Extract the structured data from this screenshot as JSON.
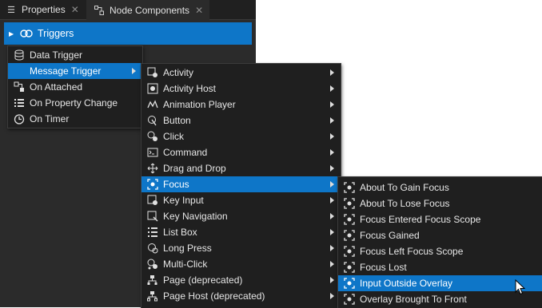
{
  "tabs": [
    {
      "label": "Properties",
      "icon": "list-icon",
      "close": "✕"
    },
    {
      "label": "Node Components",
      "icon": "node-components-icon",
      "close": "✕"
    }
  ],
  "tree": {
    "label": "Triggers",
    "icon": "trigger-icon"
  },
  "menu_level1": {
    "items": [
      {
        "label": "Data Trigger",
        "icon": "database-icon",
        "selected": false,
        "submenu": false
      },
      {
        "label": "Message Trigger",
        "icon": "message-icon",
        "selected": true,
        "submenu": true
      },
      {
        "label": "On Attached",
        "icon": "attach-icon",
        "selected": false,
        "submenu": false
      },
      {
        "label": "On Property Change",
        "icon": "property-list-icon",
        "selected": false,
        "submenu": false
      },
      {
        "label": "On Timer",
        "icon": "timer-icon",
        "selected": false,
        "submenu": false
      }
    ]
  },
  "menu_level2": {
    "items": [
      {
        "label": "Activity",
        "icon": "activity-icon"
      },
      {
        "label": "Activity Host",
        "icon": "activity-host-icon"
      },
      {
        "label": "Animation Player",
        "icon": "animation-icon"
      },
      {
        "label": "Button",
        "icon": "button-icon"
      },
      {
        "label": "Click",
        "icon": "click-icon"
      },
      {
        "label": "Command",
        "icon": "command-icon"
      },
      {
        "label": "Drag and Drop",
        "icon": "drag-drop-icon"
      },
      {
        "label": "Focus",
        "icon": "focus-icon",
        "selected": true
      },
      {
        "label": "Key Input",
        "icon": "key-input-icon"
      },
      {
        "label": "Key Navigation",
        "icon": "key-navigation-icon"
      },
      {
        "label": "List Box",
        "icon": "list-box-icon"
      },
      {
        "label": "Long Press",
        "icon": "long-press-icon"
      },
      {
        "label": "Multi-Click",
        "icon": "multi-click-icon"
      },
      {
        "label": "Page (deprecated)",
        "icon": "page-icon"
      },
      {
        "label": "Page Host (deprecated)",
        "icon": "page-host-icon"
      }
    ]
  },
  "menu_level3": {
    "items": [
      {
        "label": "About To Gain Focus",
        "icon": "focus-icon"
      },
      {
        "label": "About To Lose Focus",
        "icon": "focus-icon"
      },
      {
        "label": "Focus Entered Focus Scope",
        "icon": "focus-icon"
      },
      {
        "label": "Focus Gained",
        "icon": "focus-icon"
      },
      {
        "label": "Focus Left Focus Scope",
        "icon": "focus-icon"
      },
      {
        "label": "Focus Lost",
        "icon": "focus-icon"
      },
      {
        "label": "Input Outside Overlay",
        "icon": "focus-icon",
        "selected": true
      },
      {
        "label": "Overlay Brought To Front",
        "icon": "focus-icon"
      }
    ]
  },
  "colors": {
    "panel": "#2b2b2b",
    "menu": "#1f1f1f",
    "accent": "#0e76c8"
  }
}
